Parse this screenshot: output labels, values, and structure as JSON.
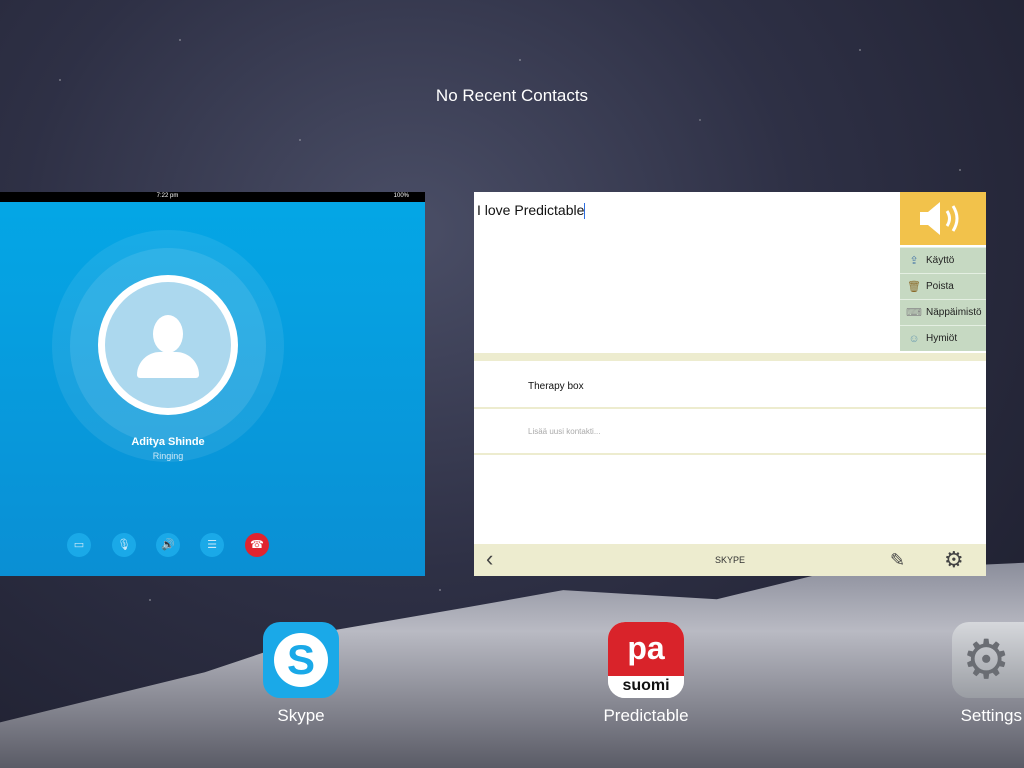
{
  "switcher": {
    "recent_contacts_text": "No Recent Contacts"
  },
  "skype_card": {
    "status_time": "7:22 pm",
    "status_battery": "100%",
    "caller_name": "Aditya Shinde",
    "caller_status": "Ringing",
    "buttons": [
      {
        "name": "video-off-button",
        "icon": "video-off-icon",
        "glyph": "▭"
      },
      {
        "name": "mute-button",
        "icon": "microphone-icon",
        "glyph": "🎙"
      },
      {
        "name": "speaker-button",
        "icon": "speaker-icon",
        "glyph": "🔊"
      },
      {
        "name": "menu-button",
        "icon": "menu-icon",
        "glyph": "☰"
      },
      {
        "name": "end-call-button",
        "icon": "hangup-icon",
        "glyph": "☎"
      }
    ],
    "accent_color": "#04a7e6",
    "end_call_color": "#e0242f"
  },
  "predictable_card": {
    "input_text": "I love Predictable",
    "side_menu": [
      {
        "label": "Käyttö",
        "icon": "share-icon"
      },
      {
        "label": "Poista",
        "icon": "trash-icon"
      },
      {
        "label": "Näppäimistö",
        "icon": "keyboard-icon"
      },
      {
        "label": "Hymiöt",
        "icon": "smiley-icon"
      }
    ],
    "contacts": [
      {
        "label": "Therapy box"
      }
    ],
    "add_contact_placeholder": "Lisää uusi kontakti...",
    "bottom_bar_title": "SKYPE",
    "speak_color": "#f2c24b",
    "menu_color": "#c6d9c2"
  },
  "dock": {
    "apps": [
      {
        "label": "Skype",
        "icon": "skype-app-icon"
      },
      {
        "label": "Predictable",
        "icon": "predictable-app-icon",
        "icon_text_top": "pa",
        "icon_text_bottom": "suomi"
      },
      {
        "label": "Settings",
        "icon": "settings-app-icon"
      }
    ]
  }
}
